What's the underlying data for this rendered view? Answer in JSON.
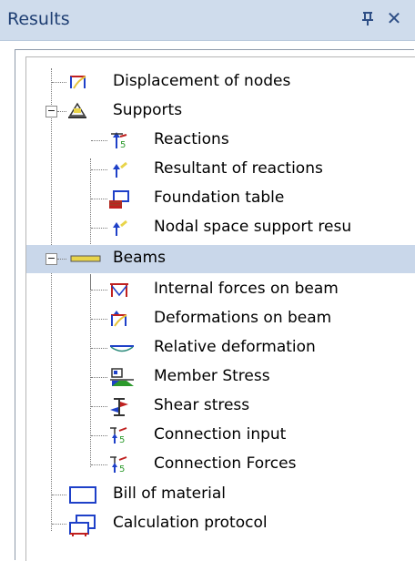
{
  "panel": {
    "title": "Results",
    "pin_glyph": "Ω",
    "close_glyph": "✕"
  },
  "tree": {
    "items": [
      {
        "label": "Displacement of nodes",
        "icon": "displacement-icon"
      },
      {
        "label": "Supports",
        "icon": "support-icon",
        "expander": "−"
      },
      {
        "label": "Reactions",
        "icon": "reactions-icon"
      },
      {
        "label": "Resultant of reactions",
        "icon": "resultant-reactions-icon"
      },
      {
        "label": "Foundation table",
        "icon": "foundation-table-icon"
      },
      {
        "label": "Nodal space support resu",
        "icon": "nodal-support-icon"
      },
      {
        "label": "Beams",
        "icon": "beam-icon",
        "expander": "−",
        "selected": true
      },
      {
        "label": "Internal forces on beam",
        "icon": "internal-forces-icon"
      },
      {
        "label": "Deformations on beam",
        "icon": "deformations-icon"
      },
      {
        "label": "Relative deformation",
        "icon": "relative-deformation-icon"
      },
      {
        "label": "Member Stress",
        "icon": "member-stress-icon"
      },
      {
        "label": "Shear stress",
        "icon": "shear-stress-icon"
      },
      {
        "label": "Connection input",
        "icon": "connection-input-icon"
      },
      {
        "label": "Connection Forces",
        "icon": "connection-forces-icon"
      },
      {
        "label": "Bill of material",
        "icon": "bill-of-material-icon"
      },
      {
        "label": "Calculation protocol",
        "icon": "calculation-protocol-icon"
      }
    ]
  },
  "colors": {
    "title_bar": "#cfdcec",
    "selection": "#c9d7ea",
    "icon_red": "#c0201f",
    "icon_blue": "#1e40c8",
    "icon_green": "#2c9a2c",
    "icon_yellow": "#e8d44a"
  }
}
